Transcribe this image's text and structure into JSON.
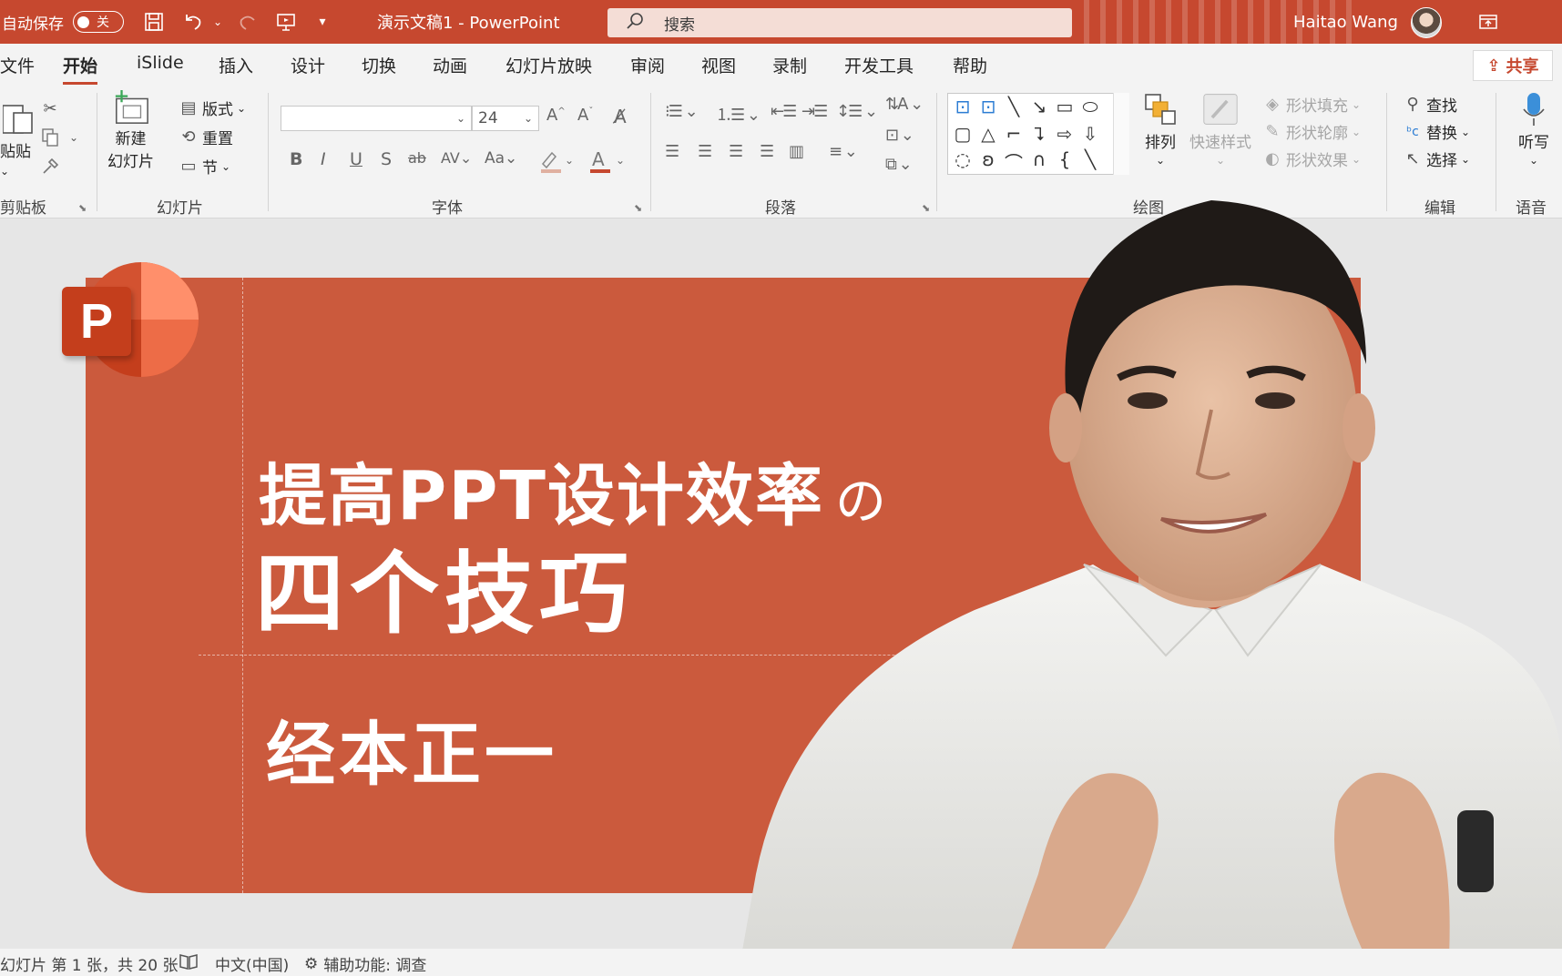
{
  "titlebar": {
    "autosave_label": "自动保存",
    "autosave_state": "关",
    "doc_title": "演示文稿1  -  PowerPoint",
    "search_placeholder": "搜索",
    "user_name": "Haitao Wang",
    "accent_color": "#c6482f"
  },
  "tabs": [
    {
      "label": "文件"
    },
    {
      "label": "开始",
      "active": true
    },
    {
      "label": "iSlide"
    },
    {
      "label": "插入"
    },
    {
      "label": "设计"
    },
    {
      "label": "切换"
    },
    {
      "label": "动画"
    },
    {
      "label": "幻灯片放映"
    },
    {
      "label": "审阅"
    },
    {
      "label": "视图"
    },
    {
      "label": "录制"
    },
    {
      "label": "开发工具"
    },
    {
      "label": "帮助"
    }
  ],
  "share_label": "共享",
  "ribbon": {
    "clipboard": {
      "label": "剪贴板",
      "paste": "贴贴"
    },
    "slides": {
      "label": "幻灯片",
      "new_slide_line1": "新建",
      "new_slide_line2": "幻灯片",
      "layout": "版式",
      "reset": "重置",
      "section": "节"
    },
    "font": {
      "label": "字体",
      "font_name": "",
      "font_size": "24"
    },
    "paragraph": {
      "label": "段落"
    },
    "drawing": {
      "label": "绘图",
      "arrange": "排列",
      "quick_styles": "快速样式",
      "shape_fill": "形状填充",
      "shape_outline": "形状轮廓",
      "shape_effects": "形状效果"
    },
    "editing": {
      "label": "编辑",
      "find": "查找",
      "replace": "替换",
      "select": "选择"
    },
    "voice": {
      "label": "语音",
      "dictate": "听写"
    }
  },
  "slide": {
    "title_line1": "提高PPT设计效率",
    "title_no": "の",
    "title_line2": "四个技巧",
    "subtitle": "经本正一",
    "background_color": "#cb5a3d"
  },
  "statusbar": {
    "slide_info": "幻灯片 第 1 张，共 20 张",
    "language": "中文(中国)",
    "accessibility": "辅助功能: 调查"
  }
}
